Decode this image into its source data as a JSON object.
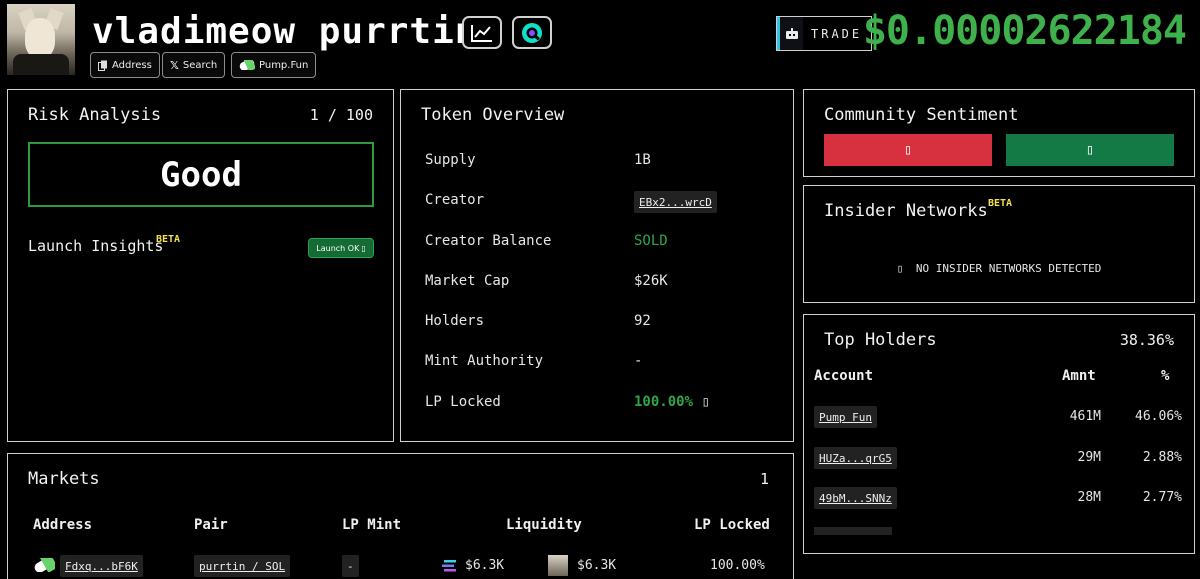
{
  "header": {
    "token_name": "vladimeow purrtin",
    "chips": [
      {
        "label": "Address",
        "icon": "copy-icon"
      },
      {
        "label": "Search",
        "icon": "x-logo-icon"
      },
      {
        "label": "Pump.Fun",
        "icon": "pill-icon"
      }
    ],
    "trade_label": "TRADE",
    "price": "$0.00002622184"
  },
  "risk": {
    "title": "Risk Analysis",
    "score": "1 / 100",
    "rating": "Good",
    "launch_insights": "Launch Insights",
    "beta": "BETA",
    "launch_badge": "Launch OK",
    "launch_badge_icon": "▯"
  },
  "overview": {
    "title": "Token Overview",
    "rows": [
      {
        "label": "Supply",
        "value": "1B"
      },
      {
        "label": "Creator",
        "value": "EBx2...wrcD"
      },
      {
        "label": "Creator Balance",
        "value": "SOLD"
      },
      {
        "label": "Market Cap",
        "value": "$26K"
      },
      {
        "label": "Holders",
        "value": "92"
      },
      {
        "label": "Mint Authority",
        "value": "-"
      },
      {
        "label": "LP Locked",
        "value": "100.00%"
      }
    ],
    "lp_icon": "▯",
    "colors": {
      "green": "#2fa54a"
    }
  },
  "sentiment": {
    "title": "Community Sentiment",
    "down_glyph": "▯",
    "up_glyph": "▯",
    "colors": {
      "down": "#d7303e",
      "up": "#137a45"
    }
  },
  "insider": {
    "title": "Insider Networks",
    "beta": "BETA",
    "icon": "▯",
    "message": "NO INSIDER NETWORKS DETECTED"
  },
  "holders": {
    "title": "Top Holders",
    "total_pct": "38.36%",
    "col_account": "Account",
    "col_amount": "Amnt",
    "col_pct": "%",
    "rows": [
      {
        "account": "Pump Fun",
        "amount": "461M",
        "pct": "46.06%"
      },
      {
        "account": "HUZa...qrG5",
        "amount": "29M",
        "pct": "2.88%"
      },
      {
        "account": "49bM...SNNz",
        "amount": "28M",
        "pct": "2.77%"
      }
    ]
  },
  "markets": {
    "title": "Markets",
    "count": "1",
    "columns": [
      "Address",
      "Pair",
      "LP Mint",
      "Liquidity",
      "LP Locked"
    ],
    "row": {
      "address": "Fdxq...bF6K",
      "pair": "purrtin / SOL",
      "lp_mint": "-",
      "liquidity_a": "$6.3K",
      "liquidity_b": "$6.3K",
      "lp_locked": "100.00%"
    }
  }
}
